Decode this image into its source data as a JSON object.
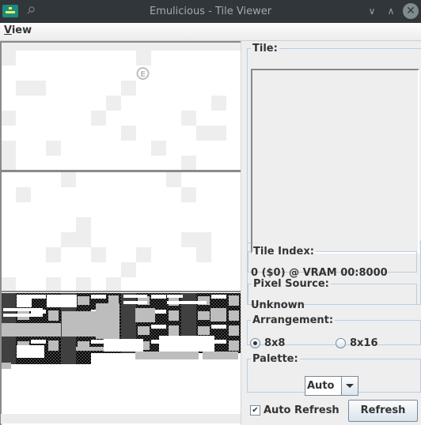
{
  "window": {
    "title": "Emulicious - Tile Viewer",
    "icons": {
      "app": "emulicious-app-icon",
      "pin": "pin-icon",
      "minimize": "chevron-down-icon",
      "maximize": "chevron-up-icon",
      "close": "close-icon"
    }
  },
  "menubar": {
    "items": [
      {
        "label": "View",
        "mnemonic": "V",
        "rest": "iew"
      }
    ]
  },
  "tile_viewer": {
    "palette_colors": {
      "white": "#ffffff",
      "light": "#eeeeee",
      "mid": "#bdbdbd",
      "dark": "#404040",
      "black": "#000000"
    },
    "light_cells_region1": [
      [
        0,
        0
      ],
      [
        0,
        1
      ],
      [
        0,
        2
      ],
      [
        0,
        3
      ],
      [
        0,
        4
      ],
      [
        0,
        5
      ],
      [
        0,
        6
      ],
      [
        0,
        7
      ],
      [
        0,
        8
      ],
      [
        0,
        9
      ],
      [
        0,
        10
      ],
      [
        0,
        11
      ],
      [
        0,
        12
      ],
      [
        0,
        13
      ],
      [
        0,
        14
      ],
      [
        0,
        15
      ],
      [
        1,
        0
      ],
      [
        1,
        9
      ],
      [
        3,
        1
      ],
      [
        3,
        2
      ],
      [
        3,
        8
      ],
      [
        4,
        7
      ],
      [
        4,
        14
      ],
      [
        5,
        0
      ],
      [
        5,
        6
      ],
      [
        5,
        12
      ],
      [
        6,
        8
      ],
      [
        6,
        13
      ],
      [
        6,
        14
      ],
      [
        7,
        0
      ],
      [
        7,
        3
      ],
      [
        7,
        10
      ],
      [
        8,
        0
      ],
      [
        8,
        12
      ]
    ],
    "light_cells_region2": [
      [
        0,
        4
      ],
      [
        0,
        11
      ],
      [
        1,
        1
      ],
      [
        1,
        12
      ],
      [
        3,
        5
      ],
      [
        4,
        4
      ],
      [
        4,
        5
      ],
      [
        4,
        12
      ],
      [
        4,
        13
      ],
      [
        5,
        3
      ],
      [
        5,
        6
      ],
      [
        5,
        9
      ],
      [
        5,
        13
      ],
      [
        6,
        8
      ],
      [
        7,
        0
      ],
      [
        7,
        3
      ],
      [
        7,
        5
      ],
      [
        7,
        7
      ]
    ],
    "dark_tile_rows": 5,
    "last_row_tile_count": 6
  },
  "side_panel": {
    "tile_label": "Tile:",
    "tile_index_label": "Tile Index:",
    "tile_index_value": "0 ($0) @ VRAM 00:8000",
    "pixel_source_label": "Pixel Source:",
    "pixel_source_value": "Unknown",
    "arrangement_label": "Arrangement:",
    "arrangement_options": [
      {
        "label": "8x8",
        "selected": true
      },
      {
        "label": "8x16",
        "selected": false
      }
    ],
    "palette_label": "Palette:",
    "palette_value": "Auto",
    "auto_refresh_label": "Auto Refresh",
    "auto_refresh_checked": true,
    "refresh_button": "Refresh"
  }
}
